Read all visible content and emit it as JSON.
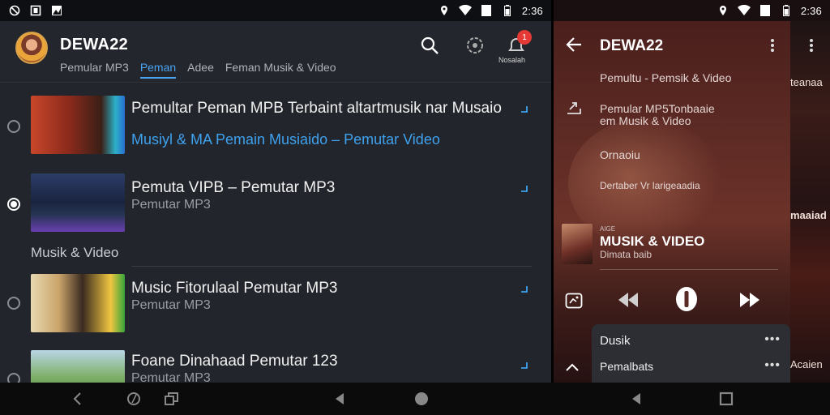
{
  "status_left": {
    "time": "2:36",
    "icons": [
      "blocked-icon",
      "square-app-icon",
      "image-icon",
      "location-icon",
      "wifi-icon",
      "signal-icon",
      "battery-icon"
    ]
  },
  "status_right": {
    "time": "2:36",
    "icons": [
      "location-icon",
      "wifi-icon",
      "signal-icon",
      "battery-icon"
    ]
  },
  "left": {
    "app_title": "DEWA22",
    "tabs": [
      {
        "label": "Pemular MP3",
        "active": false
      },
      {
        "label": "Peman",
        "active": true
      },
      {
        "label": "Adee",
        "active": false
      },
      {
        "label": "Feman Musik & Video",
        "active": false
      }
    ],
    "notification_count": "1",
    "notification_caption": "Nosalah",
    "items": [
      {
        "title": "Pemultar Peman MPB Terbaint altartmusik nar Musaio",
        "subtitle": "Musiyl & MA Pemain Musiaido – Pemutar Video",
        "selected": false
      },
      {
        "title": "Pemuta VIPB – Pemutar MP3",
        "subtitle": "Pemutar MP3",
        "selected": true
      },
      {
        "title": "Music Fitorulaal Pemutar MP3",
        "subtitle": "Pemutar MP3",
        "selected": false
      },
      {
        "title": "Foane Dinahaad Pemutar 123",
        "subtitle": "Pemutar MP3",
        "selected": false
      }
    ],
    "section_label": "Musik & Video"
  },
  "right": {
    "title": "DEWA22",
    "line1": "Pemultu - Pemsik & Video",
    "line2a": "Pemular MP5Tonbaaie",
    "line2b": "em Musik & Video",
    "line3": "Ornaoiu",
    "line4": "Dertaber Vr larigeaadia",
    "now_playing_small": "AIGE",
    "now_playing_title": "MUSIK & VIDEO",
    "now_playing_artist": "Dimata baib",
    "queue": [
      {
        "label": "Dusik",
        "more": "•••"
      },
      {
        "label": "Pemalbats",
        "more": "•••"
      }
    ]
  },
  "strip": {
    "texts": [
      "teanaa",
      "maaiad",
      "Acaien"
    ]
  },
  "colors": {
    "accent_blue": "#4aa3f0",
    "badge_red": "#e53935",
    "panel_dark": "#22252b"
  }
}
